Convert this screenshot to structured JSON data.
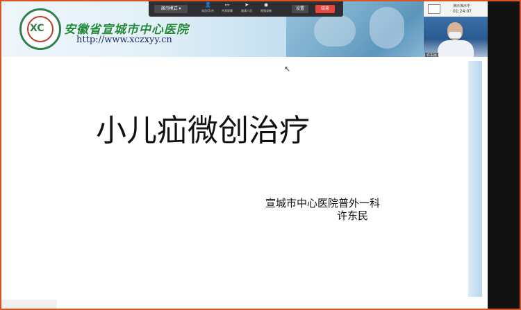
{
  "banner": {
    "hospital_name": "安徽省宣城市中心医院",
    "url": "http://www.xczxyy.cn",
    "logo_mark": "XC"
  },
  "toolbar": {
    "mode_select": "演示模式 ▾",
    "items": [
      {
        "icon": "person-icon",
        "glyph": "👤",
        "label": "成员(5)共"
      },
      {
        "icon": "camera-icon",
        "glyph": "▭",
        "label": "共享屏幕"
      },
      {
        "icon": "pointer-icon",
        "glyph": "➤",
        "label": "邀请人员"
      },
      {
        "icon": "record-icon",
        "glyph": "◉",
        "label": "视频录制"
      }
    ],
    "settings_label": "设置",
    "stop_label": "结束"
  },
  "camera": {
    "status_title": "演示演示中",
    "timer": "01:24:07",
    "participant_name": "许东民"
  },
  "slide": {
    "title": "小儿疝微创治疗",
    "department": "宣城市中心医院普外一科",
    "presenter": "许东民"
  },
  "colors": {
    "frame": "#d9541e",
    "stop_button": "#e8453c",
    "hospital_green": "#1e8a3a"
  }
}
